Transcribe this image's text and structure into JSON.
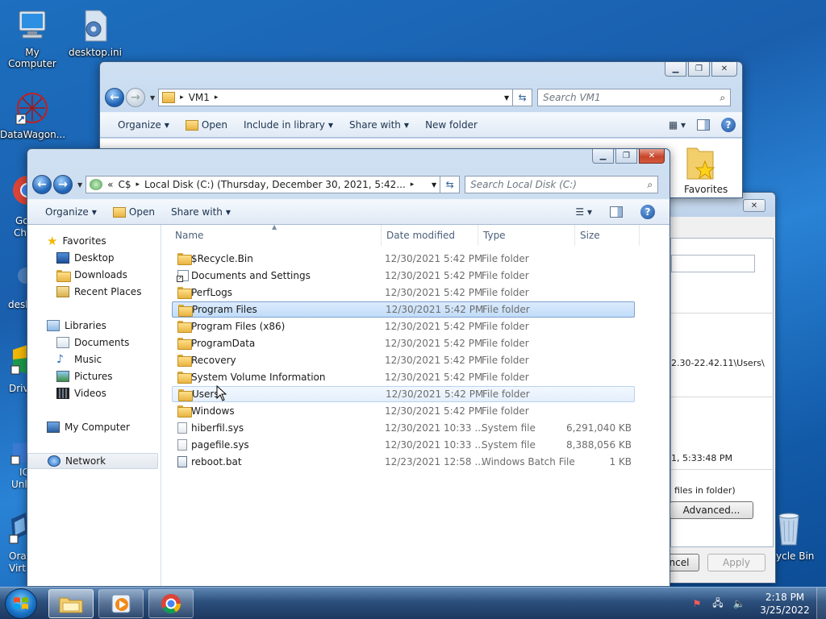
{
  "desktop": {
    "icons": [
      {
        "label": "My Computer",
        "icon": "computer-icon"
      },
      {
        "label": "desktop.ini",
        "icon": "settings-file-icon"
      },
      {
        "label": "DataWagon...",
        "icon": "datawagon-icon"
      },
      {
        "label": "Go",
        "icon": "chrome-icon"
      },
      {
        "label": "Ch",
        "icon": "chrome-icon"
      },
      {
        "label": "desk",
        "icon": "settings-file-icon"
      },
      {
        "label": "Driv",
        "icon": "drive-icon"
      },
      {
        "label": "IC",
        "icon": "shortcut-icon"
      },
      {
        "label": "Unl",
        "icon": "shortcut-icon"
      },
      {
        "label": "Orac",
        "icon": "virtualbox-icon"
      },
      {
        "label": "Virt",
        "icon": "virtualbox-icon"
      },
      {
        "label": "ycle Bin",
        "icon": "recycle-bin-icon"
      }
    ]
  },
  "back_window": {
    "address_crumb": "VM1",
    "search_placeholder": "Search VM1",
    "toolbar": [
      "Organize",
      "Open",
      "Include in library",
      "Share with",
      "New folder"
    ],
    "visible_item": "Favorites"
  },
  "properties_dialog": {
    "path_fragment": "2.30-22.42.11\\Users\\",
    "date_fragment": "1, 5:33:48 PM",
    "files_fragment": "files in folder)",
    "advanced_label": "Advanced...",
    "cancel_label": "ncel",
    "apply_label": "Apply"
  },
  "front_window": {
    "address_root": "C$",
    "address_crumb": "Local Disk (C:) (Thursday, December 30, 2021, 5:42...",
    "search_placeholder": "Search Local Disk (C:)",
    "toolbar": {
      "organize": "Organize",
      "open": "Open",
      "share": "Share with"
    },
    "nav": {
      "favorites": "Favorites",
      "desktop": "Desktop",
      "downloads": "Downloads",
      "recent": "Recent Places",
      "libraries": "Libraries",
      "documents": "Documents",
      "music": "Music",
      "pictures": "Pictures",
      "videos": "Videos",
      "computer": "My Computer",
      "network": "Network"
    },
    "columns": {
      "name": "Name",
      "date": "Date modified",
      "type": "Type",
      "size": "Size"
    },
    "rows": [
      {
        "name": "$Recycle.Bin",
        "date": "12/30/2021 5:42 PM",
        "type": "File folder",
        "size": "",
        "kind": "folder"
      },
      {
        "name": "Documents and Settings",
        "date": "12/30/2021 5:42 PM",
        "type": "File folder",
        "size": "",
        "kind": "link"
      },
      {
        "name": "PerfLogs",
        "date": "12/30/2021 5:42 PM",
        "type": "File folder",
        "size": "",
        "kind": "folder"
      },
      {
        "name": "Program Files",
        "date": "12/30/2021 5:42 PM",
        "type": "File folder",
        "size": "",
        "kind": "folder"
      },
      {
        "name": "Program Files (x86)",
        "date": "12/30/2021 5:42 PM",
        "type": "File folder",
        "size": "",
        "kind": "folder"
      },
      {
        "name": "ProgramData",
        "date": "12/30/2021 5:42 PM",
        "type": "File folder",
        "size": "",
        "kind": "folder"
      },
      {
        "name": "Recovery",
        "date": "12/30/2021 5:42 PM",
        "type": "File folder",
        "size": "",
        "kind": "folder"
      },
      {
        "name": "System Volume Information",
        "date": "12/30/2021 5:42 PM",
        "type": "File folder",
        "size": "",
        "kind": "folder"
      },
      {
        "name": "Users",
        "date": "12/30/2021 5:42 PM",
        "type": "File folder",
        "size": "",
        "kind": "folder"
      },
      {
        "name": "Windows",
        "date": "12/30/2021 5:42 PM",
        "type": "File folder",
        "size": "",
        "kind": "folder"
      },
      {
        "name": "hiberfil.sys",
        "date": "12/30/2021 10:33 ...",
        "type": "System file",
        "size": "6,291,040 KB",
        "kind": "sys"
      },
      {
        "name": "pagefile.sys",
        "date": "12/30/2021 10:33 ...",
        "type": "System file",
        "size": "8,388,056 KB",
        "kind": "sys"
      },
      {
        "name": "reboot.bat",
        "date": "12/23/2021 12:58 ...",
        "type": "Windows Batch File",
        "size": "1 KB",
        "kind": "bat"
      }
    ],
    "selected_row": "Program Files",
    "hovered_row": "Users"
  },
  "taskbar": {
    "time": "2:18 PM",
    "date": "3/25/2022"
  },
  "colors": {
    "desktop_blue": "#1a5fae",
    "selection": "#c1dcfa",
    "selection_border": "#7da2ce",
    "close_red": "#c7452a"
  }
}
